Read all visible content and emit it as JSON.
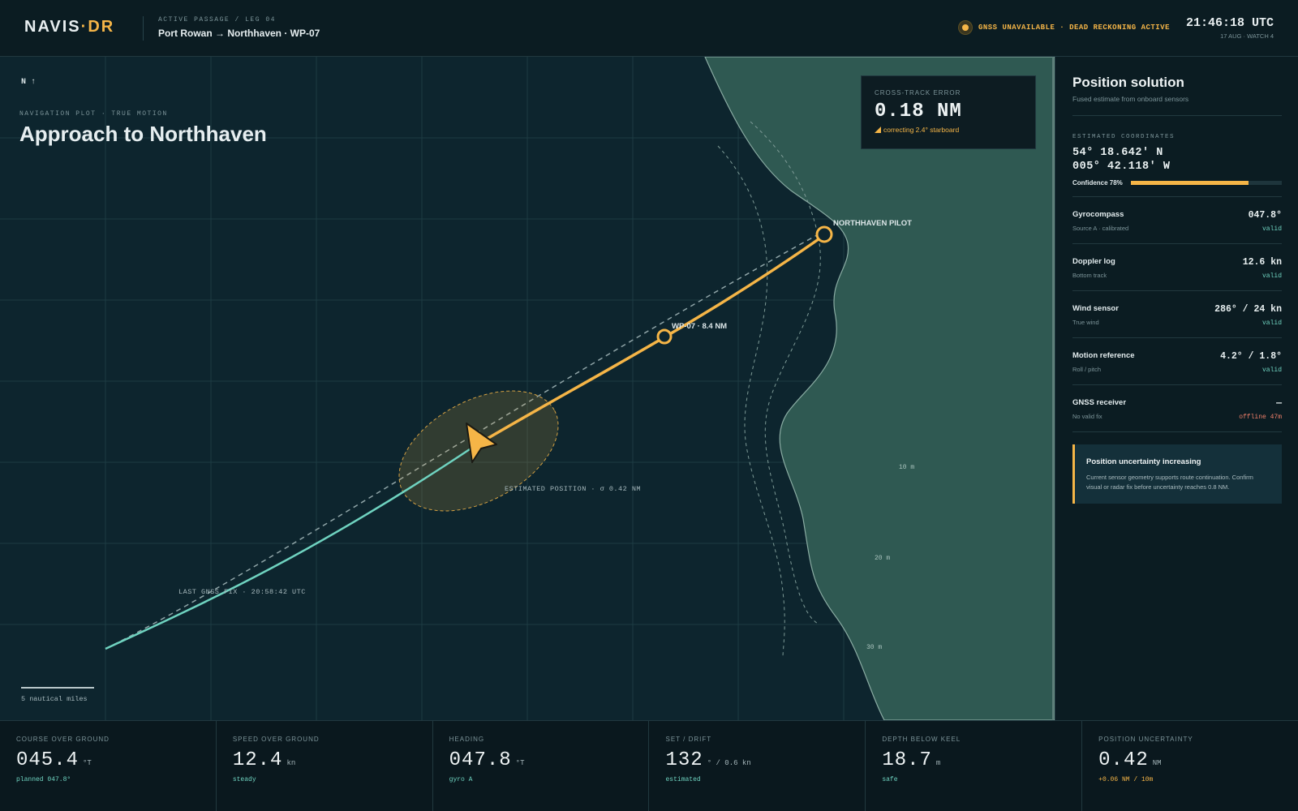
{
  "app": {
    "brand_name": "NAVIS",
    "brand_dot": "·",
    "brand_suffix": "DR"
  },
  "passage": {
    "eyebrow": "ACTIVE PASSAGE / LEG 04",
    "route": "Port Rowan → Northhaven · WP-07"
  },
  "status": {
    "gnss_alert": "GNSS UNAVAILABLE · DEAD RECKONING ACTIVE",
    "time": "21:46:18 UTC",
    "date_watch": "17 AUG · WATCH 4"
  },
  "map": {
    "north": "N ↑",
    "eyebrow": "NAVIGATION PLOT · TRUE MOTION",
    "title": "Approach to Northhaven",
    "xte": {
      "label": "CROSS-TRACK ERROR",
      "value": "0.18 NM",
      "note": "correcting 2.4° starboard"
    },
    "waypoints": [
      {
        "label": "NORTHHAVEN PILOT"
      },
      {
        "label": "WP-07 · 8.4 NM"
      }
    ],
    "estimated_position_label": "ESTIMATED POSITION · σ 0.42 NM",
    "last_fix_label": "LAST GNSS FIX · 20:58:42 UTC",
    "depth_contours": [
      "10 m",
      "20 m",
      "30 m"
    ],
    "scale_label": "5 nautical miles",
    "icons": [
      "vessel-arrow-icon",
      "waypoint-icon",
      "uncertainty-ellipse"
    ],
    "colors": {
      "route": "#f5b547",
      "track": "#6fd3c0",
      "land": "#2f5952",
      "sea": "#0d252e"
    }
  },
  "panel": {
    "title": "Position solution",
    "subtitle": "Fused estimate from onboard sensors",
    "coords_eyebrow": "ESTIMATED COORDINATES",
    "lat": "54° 18.642′ N",
    "lon": "005° 42.118′ W",
    "confidence_label": "Confidence 78%",
    "confidence": 0.78,
    "sensors": [
      {
        "name": "Gyrocompass",
        "sub": "Source A · calibrated",
        "value": "047.8°",
        "status": "valid",
        "state": "ok"
      },
      {
        "name": "Doppler log",
        "sub": "Bottom track",
        "value": "12.6 kn",
        "status": "valid",
        "state": "ok"
      },
      {
        "name": "Wind sensor",
        "sub": "True wind",
        "value": "286° / 24 kn",
        "status": "valid",
        "state": "ok"
      },
      {
        "name": "Motion reference",
        "sub": "Roll / pitch",
        "value": "4.2° / 1.8°",
        "status": "valid",
        "state": "ok"
      },
      {
        "name": "GNSS receiver",
        "sub": "No valid fix",
        "value": "—",
        "status": "offline 47m",
        "state": "error"
      }
    ],
    "alert": {
      "title": "Position uncertainty increasing",
      "body": "Current sensor geometry supports route continuation. Confirm visual or radar fix before uncertainty reaches 0.8 NM."
    }
  },
  "metrics": [
    {
      "label": "COURSE OVER GROUND",
      "value": "045.4",
      "unit": "°T",
      "note": "planned 047.8°",
      "tone": "teal"
    },
    {
      "label": "SPEED OVER GROUND",
      "value": "12.4",
      "unit": "kn",
      "note": "steady",
      "tone": "teal"
    },
    {
      "label": "HEADING",
      "value": "047.8",
      "unit": "°T",
      "note": "gyro A",
      "tone": "teal"
    },
    {
      "label": "SET / DRIFT",
      "value": "132",
      "unit": "° / 0.6 kn",
      "note": "estimated",
      "tone": "teal"
    },
    {
      "label": "DEPTH BELOW KEEL",
      "value": "18.7",
      "unit": "m",
      "note": "safe",
      "tone": "teal"
    },
    {
      "label": "POSITION UNCERTAINTY",
      "value": "0.42",
      "unit": "NM",
      "note": "+0.06 NM / 10m",
      "tone": "accent"
    }
  ]
}
